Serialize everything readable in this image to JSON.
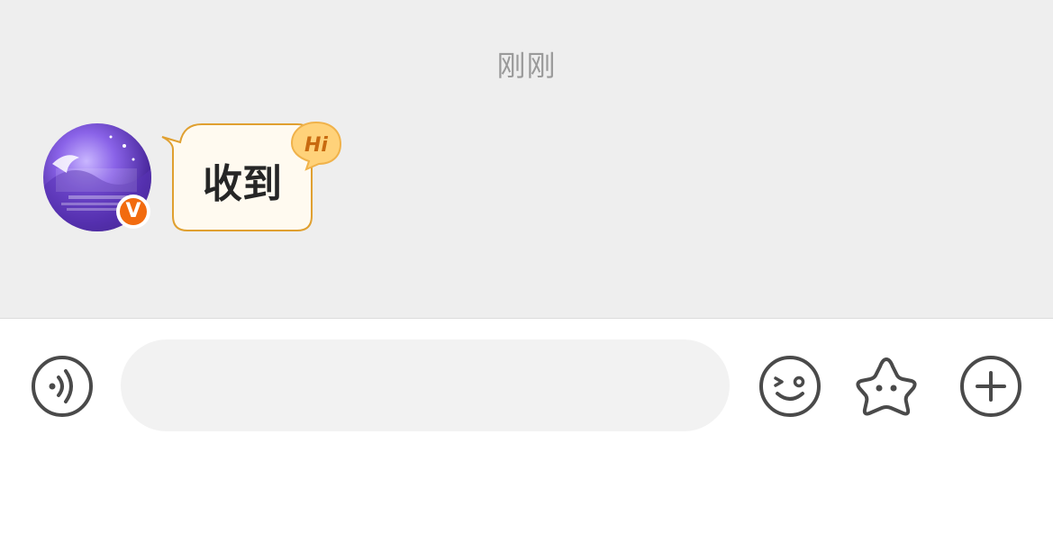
{
  "chat": {
    "timestamp": "刚刚",
    "message": {
      "text": "收到",
      "badge": "Hi",
      "sender_avatar": "avatar",
      "verified_badge": "V"
    }
  },
  "input_bar": {
    "voice_icon": "voice-icon",
    "text_value": "",
    "emoji_icon": "emoji-icon",
    "sticker_icon": "star-sticker-icon",
    "more_icon": "plus-icon"
  },
  "colors": {
    "chat_bg": "#eeeeee",
    "bubble_fill": "#fffaf0",
    "bubble_border": "#e0a030",
    "badge_orange": "#f26b0f",
    "icon_gray": "#4a4a4a"
  }
}
